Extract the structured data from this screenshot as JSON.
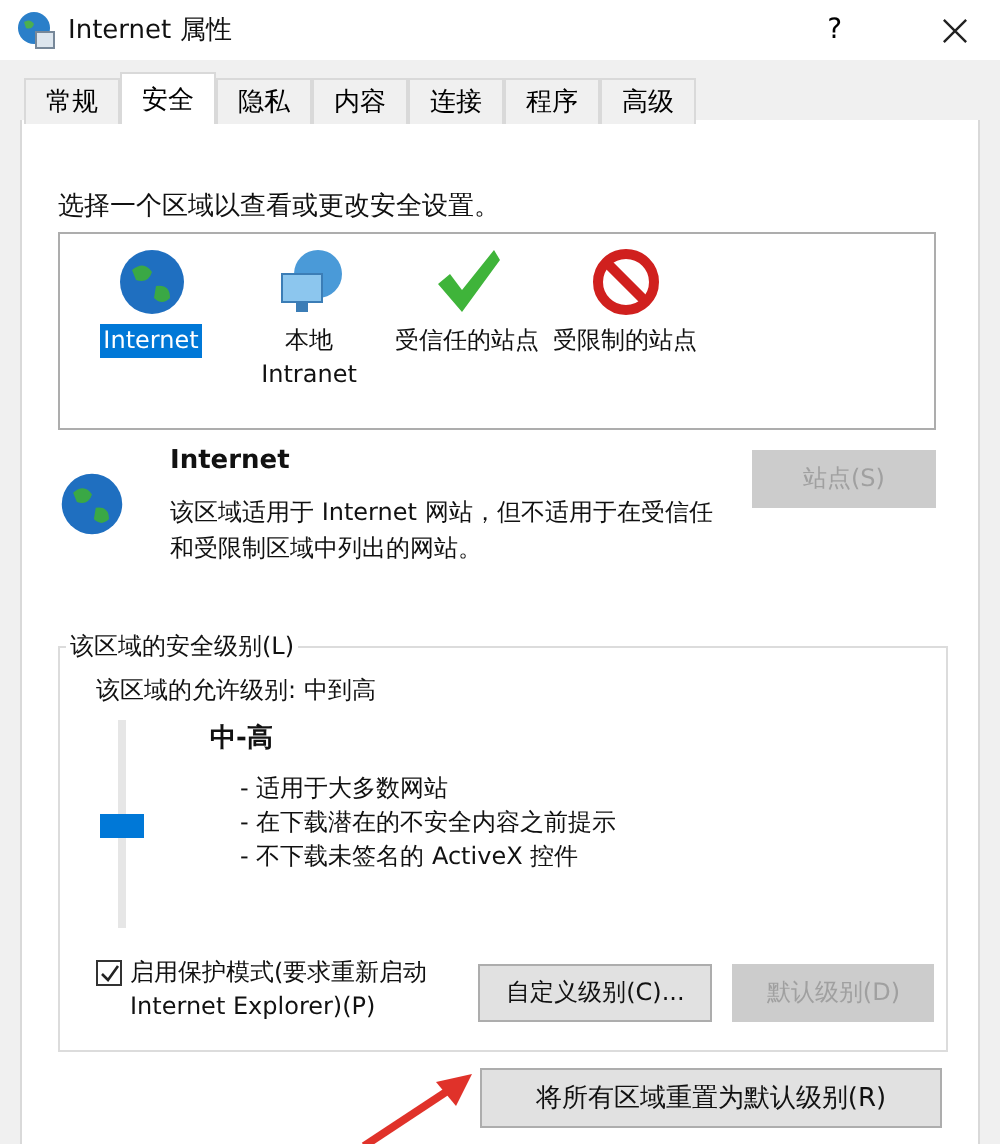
{
  "window": {
    "title": "Internet 属性",
    "help": "?"
  },
  "tabs": [
    {
      "label": "常规",
      "selected": false
    },
    {
      "label": "安全",
      "selected": true
    },
    {
      "label": "隐私",
      "selected": false
    },
    {
      "label": "内容",
      "selected": false
    },
    {
      "label": "连接",
      "selected": false
    },
    {
      "label": "程序",
      "selected": false
    },
    {
      "label": "高级",
      "selected": false
    }
  ],
  "prompt": "选择一个区域以查看或更改安全设置。",
  "zones": [
    {
      "kind": "globe",
      "label": "Internet",
      "selected": true
    },
    {
      "kind": "intranet",
      "label": "本地 Intranet",
      "selected": false
    },
    {
      "kind": "trusted",
      "label": "受信任的站点",
      "selected": false
    },
    {
      "kind": "restricted",
      "label": "受限制的站点",
      "selected": false
    }
  ],
  "zone_info": {
    "title": "Internet",
    "description": "该区域适用于 Internet 网站，但不适用于在受信任和受限制区域中列出的网站。",
    "sites_button": {
      "label": "站点(S)",
      "disabled": true
    }
  },
  "security_level": {
    "title": "该区域的安全级别(L)",
    "allowed": "该区域的允许级别: 中到高",
    "level": 0.5,
    "level_name": "中-高",
    "bullets": [
      "- 适用于大多数网站",
      "- 在下载潜在的不安全内容之前提示",
      "- 不下载未签名的 ActiveX 控件"
    ],
    "protected_mode": {
      "label": "启用保护模式(要求重新启动 Internet Explorer)(P)",
      "checked": true
    },
    "buttons": [
      {
        "label": "自定义级别(C)...",
        "disabled": false
      },
      {
        "label": "默认级别(D)",
        "disabled": true
      }
    ]
  },
  "reset_button": {
    "label": "将所有区域重置为默认级别(R)",
    "disabled": false
  }
}
